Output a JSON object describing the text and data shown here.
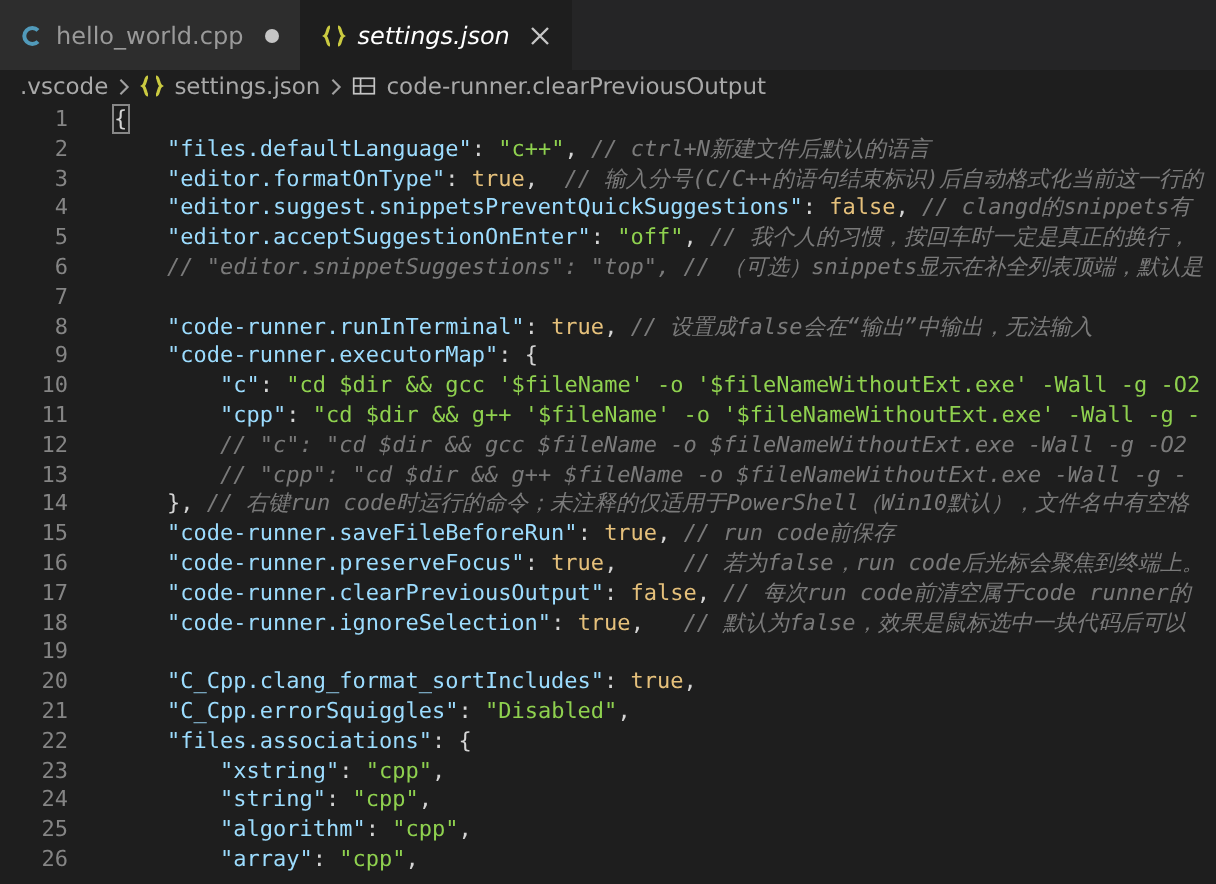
{
  "tabs": [
    {
      "label": "hello_world.cpp",
      "kind": "cpp",
      "selected": false,
      "modified": true,
      "preview": false
    },
    {
      "label": "settings.json",
      "kind": "json",
      "selected": true,
      "modified": false,
      "preview": true
    }
  ],
  "breadcrumb": [
    {
      "label": ".vscode",
      "kind": "folder"
    },
    {
      "label": "settings.json",
      "kind": "json"
    },
    {
      "label": "code-runner.clearPreviousOutput",
      "kind": "property"
    }
  ],
  "editor": {
    "lines": [
      {
        "number": "1",
        "tokens": [
          {
            "kind": "brace",
            "text": "{"
          }
        ],
        "children": [
          {
            "number": "2",
            "tokens": [
              {
                "kind": "key",
                "text": "\"files.defaultLanguage\""
              },
              {
                "kind": "plain",
                "text": ": "
              },
              {
                "kind": "string",
                "text": "\"c++\""
              },
              {
                "kind": "plain",
                "text": ", "
              },
              {
                "kind": "comment",
                "text": "// ctrl+N新建文件后默认的语言"
              }
            ]
          },
          {
            "number": "3",
            "tokens": [
              {
                "kind": "key",
                "text": "\"editor.formatOnType\""
              },
              {
                "kind": "plain",
                "text": ": "
              },
              {
                "kind": "bool",
                "text": "true"
              },
              {
                "kind": "plain",
                "text": ",  "
              },
              {
                "kind": "comment",
                "text": "// 输入分号(C/C++的语句结束标识)后自动格式化当前这一行的"
              }
            ]
          },
          {
            "number": "4",
            "tokens": [
              {
                "kind": "key",
                "text": "\"editor.suggest.snippetsPreventQuickSuggestions\""
              },
              {
                "kind": "plain",
                "text": ": "
              },
              {
                "kind": "bool",
                "text": "false"
              },
              {
                "kind": "plain",
                "text": ", "
              },
              {
                "kind": "comment",
                "text": "// clangd的snippets有"
              }
            ]
          },
          {
            "number": "5",
            "tokens": [
              {
                "kind": "key",
                "text": "\"editor.acceptSuggestionOnEnter\""
              },
              {
                "kind": "plain",
                "text": ": "
              },
              {
                "kind": "string",
                "text": "\"off\""
              },
              {
                "kind": "plain",
                "text": ", "
              },
              {
                "kind": "comment",
                "text": "// 我个人的习惯，按回车时一定是真正的换行，"
              }
            ]
          },
          {
            "number": "6",
            "tokens": [
              {
                "kind": "comment",
                "text": "// \"editor.snippetSuggestions\": \"top\", // （可选）snippets显示在补全列表顶端，默认是"
              }
            ]
          },
          {
            "number": "7"
          },
          {
            "number": "8",
            "tokens": [
              {
                "kind": "key",
                "text": "\"code-runner.runInTerminal\""
              },
              {
                "kind": "plain",
                "text": ": "
              },
              {
                "kind": "bool",
                "text": "true"
              },
              {
                "kind": "plain",
                "text": ", "
              },
              {
                "kind": "comment",
                "text": "// 设置成false会在“输出”中输出，无法输入"
              }
            ]
          },
          {
            "number": "9",
            "tokens": [
              {
                "kind": "key",
                "text": "\"code-runner.executorMap\""
              },
              {
                "kind": "plain",
                "text": ": {"
              }
            ],
            "children": [
              {
                "number": "10",
                "tokens": [
                  {
                    "kind": "key",
                    "text": "\"c\""
                  },
                  {
                    "kind": "plain",
                    "text": ": "
                  },
                  {
                    "kind": "string",
                    "text": "\"cd $dir && gcc '$fileName' -o '$fileNameWithoutExt.exe' -Wall -g -O2"
                  }
                ]
              },
              {
                "number": "11",
                "tokens": [
                  {
                    "kind": "key",
                    "text": "\"cpp\""
                  },
                  {
                    "kind": "plain",
                    "text": ": "
                  },
                  {
                    "kind": "string",
                    "text": "\"cd $dir && g++ '$fileName' -o '$fileNameWithoutExt.exe' -Wall -g -"
                  }
                ]
              },
              {
                "number": "12",
                "tokens": [
                  {
                    "kind": "comment",
                    "text": "// \"c\": \"cd $dir && gcc $fileName -o $fileNameWithoutExt.exe -Wall -g -O2"
                  }
                ]
              },
              {
                "number": "13",
                "tokens": [
                  {
                    "kind": "comment",
                    "text": "// \"cpp\": \"cd $dir && g++ $fileName -o $fileNameWithoutExt.exe -Wall -g -"
                  }
                ]
              }
            ]
          },
          {
            "number": "14",
            "tokens": [
              {
                "kind": "plain",
                "text": "}, "
              },
              {
                "kind": "comment",
                "text": "// 右键run code时运行的命令；未注释的仅适用于PowerShell（Win10默认），文件名中有空格"
              }
            ]
          },
          {
            "number": "15",
            "tokens": [
              {
                "kind": "key",
                "text": "\"code-runner.saveFileBeforeRun\""
              },
              {
                "kind": "plain",
                "text": ": "
              },
              {
                "kind": "bool",
                "text": "true"
              },
              {
                "kind": "plain",
                "text": ", "
              },
              {
                "kind": "comment",
                "text": "// run code前保存"
              }
            ]
          },
          {
            "number": "16",
            "tokens": [
              {
                "kind": "key",
                "text": "\"code-runner.preserveFocus\""
              },
              {
                "kind": "plain",
                "text": ": "
              },
              {
                "kind": "bool",
                "text": "true"
              },
              {
                "kind": "plain",
                "text": ",     "
              },
              {
                "kind": "comment",
                "text": "// 若为false，run code后光标会聚焦到终端上。"
              }
            ]
          },
          {
            "number": "17",
            "tokens": [
              {
                "kind": "key",
                "text": "\"code-runner.clearPreviousOutput\""
              },
              {
                "kind": "plain",
                "text": ": "
              },
              {
                "kind": "bool",
                "text": "false"
              },
              {
                "kind": "plain",
                "text": ", "
              },
              {
                "kind": "comment",
                "text": "// 每次run code前清空属于code runner的"
              }
            ]
          },
          {
            "number": "18",
            "tokens": [
              {
                "kind": "key",
                "text": "\"code-runner.ignoreSelection\""
              },
              {
                "kind": "plain",
                "text": ": "
              },
              {
                "kind": "bool",
                "text": "true"
              },
              {
                "kind": "plain",
                "text": ",   "
              },
              {
                "kind": "comment",
                "text": "// 默认为false，效果是鼠标选中一块代码后可以"
              }
            ]
          },
          {
            "number": "19"
          },
          {
            "number": "20",
            "tokens": [
              {
                "kind": "key",
                "text": "\"C_Cpp.clang_format_sortIncludes\""
              },
              {
                "kind": "plain",
                "text": ": "
              },
              {
                "kind": "bool",
                "text": "true"
              },
              {
                "kind": "plain",
                "text": ","
              }
            ]
          },
          {
            "number": "21",
            "tokens": [
              {
                "kind": "key",
                "text": "\"C_Cpp.errorSquiggles\""
              },
              {
                "kind": "plain",
                "text": ": "
              },
              {
                "kind": "string",
                "text": "\"Disabled\""
              },
              {
                "kind": "plain",
                "text": ","
              }
            ]
          },
          {
            "number": "22",
            "tokens": [
              {
                "kind": "key",
                "text": "\"files.associations\""
              },
              {
                "kind": "plain",
                "text": ": {"
              }
            ],
            "children": [
              {
                "number": "23",
                "tokens": [
                  {
                    "kind": "key",
                    "text": "\"xstring\""
                  },
                  {
                    "kind": "plain",
                    "text": ": "
                  },
                  {
                    "kind": "string",
                    "text": "\"cpp\""
                  },
                  {
                    "kind": "plain",
                    "text": ","
                  }
                ]
              },
              {
                "number": "24",
                "tokens": [
                  {
                    "kind": "key",
                    "text": "\"string\""
                  },
                  {
                    "kind": "plain",
                    "text": ": "
                  },
                  {
                    "kind": "string",
                    "text": "\"cpp\""
                  },
                  {
                    "kind": "plain",
                    "text": ","
                  }
                ]
              },
              {
                "number": "25",
                "tokens": [
                  {
                    "kind": "key",
                    "text": "\"algorithm\""
                  },
                  {
                    "kind": "plain",
                    "text": ": "
                  },
                  {
                    "kind": "string",
                    "text": "\"cpp\""
                  },
                  {
                    "kind": "plain",
                    "text": ","
                  }
                ]
              },
              {
                "number": "26",
                "tokens": [
                  {
                    "kind": "key",
                    "text": "\"array\""
                  },
                  {
                    "kind": "plain",
                    "text": ": "
                  },
                  {
                    "kind": "string",
                    "text": "\"cpp\""
                  },
                  {
                    "kind": "plain",
                    "text": ","
                  }
                ]
              }
            ]
          }
        ]
      }
    ]
  }
}
